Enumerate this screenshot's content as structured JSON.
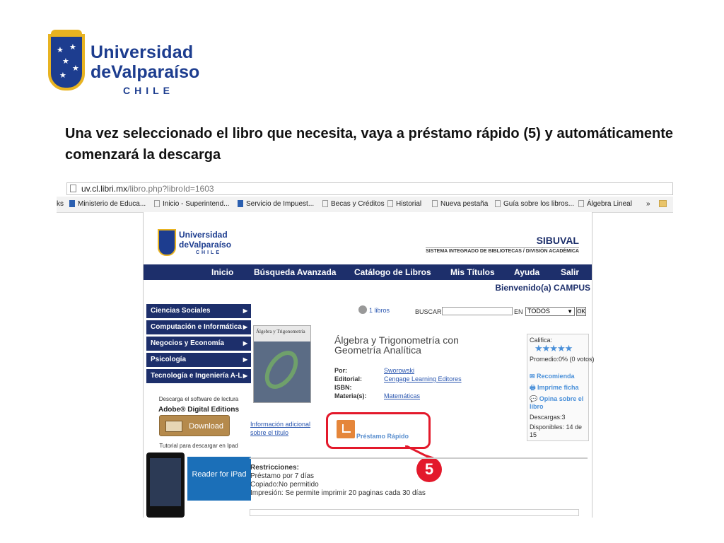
{
  "logo": {
    "line1": "Universidad",
    "line2": "deValparaíso",
    "line3": "CHILE"
  },
  "instruction": "Una vez seleccionado el libro que necesita, vaya a préstamo rápido (5) y automáticamente comenzará la descarga",
  "browser": {
    "url_host": "uv.cl.libri.mx",
    "url_path": "/libro.php?libroId=1603",
    "bookmarks": [
      "Ministerio de Educa...",
      "Inicio - Superintend...",
      "Servicio de Impuest...",
      "Becas y Créditos",
      "Historial",
      "Nueva pestaña",
      "Guía sobre los libros...",
      "Álgebra Lineal"
    ],
    "bookmarks_more": "»",
    "left_partial": "ks"
  },
  "site": {
    "logo_line1": "Universidad",
    "logo_line2": "deValparaíso",
    "logo_line3": "CHILE",
    "system_name": "SIBUVAL",
    "system_sub": "SISTEMA INTEGRADO DE BIBLIOTECAS / DIVISIÓN ACADÉMICA",
    "nav": [
      "Inicio",
      "Búsqueda Avanzada",
      "Catálogo de Libros",
      "Mis Títulos",
      "Ayuda",
      "Salir"
    ],
    "welcome": "Bienvenido(a) CAMPUS",
    "categories": [
      "Ciencias Sociales",
      "Computación e Informática",
      "Negocios y Economía",
      "Psicología",
      "Tecnología e Ingeniería A-L"
    ],
    "download_caption": "Descarga el software de lectura",
    "adobe_label": "Adobe® Digital Editions",
    "download_button": "Download",
    "tutorial_caption": "Tutorial para descargar en Ipad",
    "reader_text": "Reader for iPad",
    "cart": "1 libros",
    "search_label": "BUSCAR",
    "search_in": "EN",
    "search_select": "TODOS",
    "search_ok": "OK",
    "book": {
      "cover_title": "Álgebra y Trigonometría",
      "title": "Álgebra y Trigonometría con Geometría Analítica",
      "fields": [
        {
          "label": "Por:",
          "value": "Sworowski"
        },
        {
          "label": "Editorial:",
          "value": "Cengage Learning Editores"
        },
        {
          "label": "ISBN:",
          "value": ""
        },
        {
          "label": "Materia(s):",
          "value": "Matemáticas"
        }
      ]
    },
    "info_link": "Información adicional sobre el título",
    "prestamo": "Préstamo Rápido",
    "callout_number": "5",
    "side": {
      "califica": "Califica:",
      "promedio": "Promedio:0% (0 votos)",
      "recomienda": "Recomienda",
      "imprime": "Imprime ficha",
      "opina": "Opina sobre el libro",
      "descargas": "Descargas:3",
      "disponibles": "Disponibles: 14 de 15"
    },
    "restricciones": {
      "heading": "Restricciones:",
      "lines": [
        "Préstamo por 7 días",
        "Copiado:No permitido",
        "Impresión: Se permite imprimir 20 paginas cada 30 días"
      ]
    }
  },
  "colors": {
    "brand_blue": "#1d3d8f",
    "nav_blue": "#1d2f6b",
    "gold": "#e8b321",
    "callout_red": "#e3192b"
  }
}
